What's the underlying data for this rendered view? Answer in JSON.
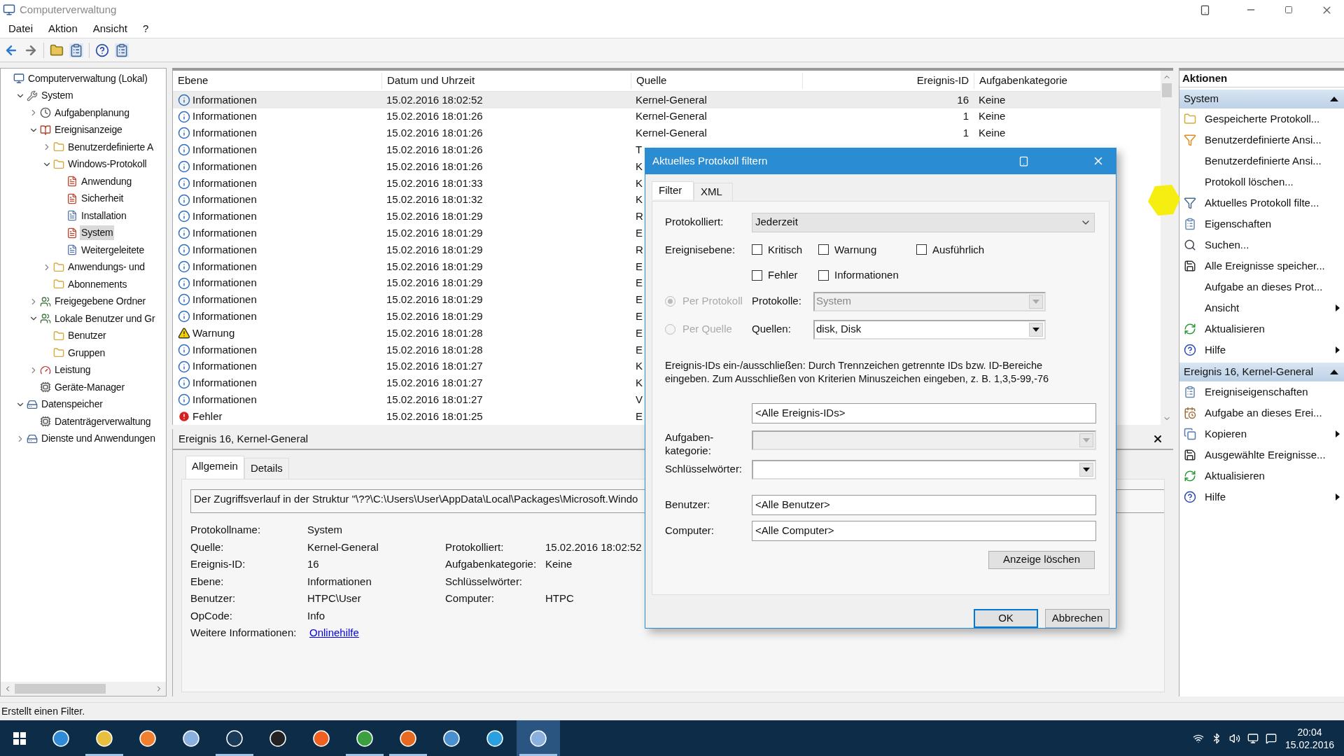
{
  "window": {
    "title": "Computerverwaltung"
  },
  "menu": [
    "Datei",
    "Aktion",
    "Ansicht",
    "?"
  ],
  "tree": [
    {
      "label": "Computerverwaltung (Lokal)",
      "kind": "computer",
      "selected": false,
      "children": [
        {
          "label": "System",
          "kind": "tool",
          "expanded": true,
          "selected": false,
          "children": [
            {
              "label": "Aufgabenplanung",
              "kind": "clock",
              "expanded": false,
              "selected": false
            },
            {
              "label": "Ereignisanzeige",
              "kind": "viewer",
              "expanded": true,
              "selected": false,
              "children": [
                {
                  "label": "Benutzerdefinierte A",
                  "kind": "folder",
                  "expanded": false,
                  "selected": false
                },
                {
                  "label": "Windows-Protokoll",
                  "kind": "folder",
                  "expanded": true,
                  "selected": false,
                  "children": [
                    {
                      "label": "Anwendung",
                      "kind": "log",
                      "selected": false
                    },
                    {
                      "label": "Sicherheit",
                      "kind": "log",
                      "selected": false
                    },
                    {
                      "label": "Installation",
                      "kind": "plainlog",
                      "selected": false
                    },
                    {
                      "label": "System",
                      "kind": "log",
                      "selected": true
                    },
                    {
                      "label": "Weitergeleitete",
                      "kind": "plainlog",
                      "selected": false
                    }
                  ]
                },
                {
                  "label": "Anwendungs- und",
                  "kind": "folder",
                  "expanded": false,
                  "selected": false
                },
                {
                  "label": "Abonnements",
                  "kind": "folder",
                  "selected": false
                }
              ]
            },
            {
              "label": "Freigegebene Ordner",
              "kind": "users",
              "expanded": false,
              "selected": false
            },
            {
              "label": "Lokale Benutzer und Gr",
              "kind": "users",
              "expanded": true,
              "selected": false,
              "children": [
                {
                  "label": "Benutzer",
                  "kind": "folder",
                  "selected": false
                },
                {
                  "label": "Gruppen",
                  "kind": "folder",
                  "selected": false
                }
              ]
            },
            {
              "label": "Leistung",
              "kind": "perf",
              "expanded": false,
              "selected": false
            },
            {
              "label": "Geräte-Manager",
              "kind": "device",
              "selected": false
            }
          ]
        },
        {
          "label": "Datenspeicher",
          "kind": "storage",
          "expanded": true,
          "selected": false,
          "children": [
            {
              "label": "Datenträgerverwaltung",
              "kind": "device",
              "selected": false
            }
          ]
        },
        {
          "label": "Dienste und Anwendungen",
          "kind": "storage",
          "expanded": false,
          "selected": false
        }
      ]
    }
  ],
  "table": {
    "columns": [
      "Ebene",
      "Datum und Uhrzeit",
      "Quelle",
      "Ereignis-ID",
      "Aufgabenkategorie"
    ],
    "rows": [
      {
        "kind": "info",
        "level": "Informationen",
        "date": "15.02.2016 18:02:52",
        "source": "Kernel-General",
        "id": "16",
        "category": "Keine",
        "selected": true
      },
      {
        "kind": "info",
        "level": "Informationen",
        "date": "15.02.2016 18:01:26",
        "source": "Kernel-General",
        "id": "1",
        "category": "Keine",
        "selected": false
      },
      {
        "kind": "info",
        "level": "Informationen",
        "date": "15.02.2016 18:01:26",
        "source": "Kernel-General",
        "id": "1",
        "category": "Keine",
        "selected": false
      },
      {
        "kind": "info",
        "level": "Informationen",
        "date": "15.02.2016 18:01:26",
        "source": "T",
        "selected": false
      },
      {
        "kind": "info",
        "level": "Informationen",
        "date": "15.02.2016 18:01:26",
        "source": "K",
        "selected": false
      },
      {
        "kind": "info",
        "level": "Informationen",
        "date": "15.02.2016 18:01:33",
        "source": "K",
        "selected": false
      },
      {
        "kind": "info",
        "level": "Informationen",
        "date": "15.02.2016 18:01:32",
        "source": "K",
        "selected": false
      },
      {
        "kind": "info",
        "level": "Informationen",
        "date": "15.02.2016 18:01:29",
        "source": "R",
        "selected": false
      },
      {
        "kind": "info",
        "level": "Informationen",
        "date": "15.02.2016 18:01:29",
        "source": "E",
        "selected": false
      },
      {
        "kind": "info",
        "level": "Informationen",
        "date": "15.02.2016 18:01:29",
        "source": "R",
        "selected": false
      },
      {
        "kind": "info",
        "level": "Informationen",
        "date": "15.02.2016 18:01:29",
        "source": "E",
        "selected": false
      },
      {
        "kind": "info",
        "level": "Informationen",
        "date": "15.02.2016 18:01:29",
        "source": "E",
        "selected": false
      },
      {
        "kind": "info",
        "level": "Informationen",
        "date": "15.02.2016 18:01:29",
        "source": "E",
        "selected": false
      },
      {
        "kind": "info",
        "level": "Informationen",
        "date": "15.02.2016 18:01:29",
        "source": "E",
        "selected": false
      },
      {
        "kind": "warning",
        "level": "Warnung",
        "date": "15.02.2016 18:01:28",
        "source": "E",
        "selected": false
      },
      {
        "kind": "info",
        "level": "Informationen",
        "date": "15.02.2016 18:01:28",
        "source": "E",
        "selected": false
      },
      {
        "kind": "info",
        "level": "Informationen",
        "date": "15.02.2016 18:01:27",
        "source": "K",
        "selected": false
      },
      {
        "kind": "info",
        "level": "Informationen",
        "date": "15.02.2016 18:01:27",
        "source": "K",
        "selected": false
      },
      {
        "kind": "info",
        "level": "Informationen",
        "date": "15.02.2016 18:01:27",
        "source": "V",
        "selected": false
      },
      {
        "kind": "error",
        "level": "Fehler",
        "date": "15.02.2016 18:01:25",
        "source": "E",
        "selected": false
      }
    ]
  },
  "details": {
    "title": "Ereignis 16, Kernel-General",
    "tabs": [
      {
        "label": "Allgemein",
        "selected": true
      },
      {
        "label": "Details",
        "selected": false
      }
    ],
    "message": "Der Zugriffsverlauf in der Struktur \"\\??\\C:\\Users\\User\\AppData\\Local\\Packages\\Microsoft.Windo",
    "rows": [
      {
        "left": {
          "label": "Protokollname:",
          "value": "System"
        }
      },
      {
        "left": {
          "label": "Quelle:",
          "value": "Kernel-General"
        },
        "right": {
          "label": "Protokolliert:",
          "value": "15.02.2016 18:02:52"
        }
      },
      {
        "left": {
          "label": "Ereignis-ID:",
          "value": "16"
        },
        "right": {
          "label": "Aufgabenkategorie:",
          "value": "Keine"
        }
      },
      {
        "left": {
          "label": "Ebene:",
          "value": "Informationen"
        },
        "right": {
          "label": "Schlüsselwörter:"
        }
      },
      {
        "left": {
          "label": "Benutzer:",
          "value": "HTPC\\User"
        },
        "right": {
          "label": "Computer:",
          "value": "HTPC"
        }
      },
      {
        "left": {
          "label": "OpCode:",
          "value": "Info"
        }
      }
    ],
    "more_info": {
      "label": "Weitere Informationen:",
      "link": "Onlinehilfe"
    }
  },
  "actions": {
    "title": "Aktionen",
    "sections": [
      {
        "title": "System",
        "expanded": true,
        "items": [
          {
            "label": "Gespeicherte Protokoll...",
            "kind": "folder",
            "submenu": false
          },
          {
            "label": "Benutzerdefinierte Ansi...",
            "kind": "filter",
            "submenu": false
          },
          {
            "label": "Benutzerdefinierte Ansi...",
            "kind": "none",
            "submenu": false
          },
          {
            "label": "Protokoll löschen...",
            "kind": "none",
            "submenu": false
          },
          {
            "label": "Aktuelles Protokoll filte...",
            "kind": "funnel",
            "submenu": false
          },
          {
            "label": "Eigenschaften",
            "kind": "props",
            "submenu": false
          },
          {
            "label": "Suchen...",
            "kind": "search",
            "submenu": false
          },
          {
            "label": "Alle Ereignisse speicher...",
            "kind": "save",
            "submenu": false
          },
          {
            "label": "Aufgabe an dieses Prot...",
            "kind": "none",
            "submenu": false
          },
          {
            "label": "Ansicht",
            "kind": "none",
            "submenu": true
          },
          {
            "label": "Aktualisieren",
            "kind": "refresh",
            "submenu": false
          },
          {
            "label": "Hilfe",
            "kind": "help",
            "submenu": true
          }
        ]
      },
      {
        "title": "Ereignis 16, Kernel-General",
        "expanded": true,
        "items": [
          {
            "label": "Ereigniseigenschaften",
            "kind": "props",
            "submenu": false
          },
          {
            "label": "Aufgabe an dieses Erei...",
            "kind": "task",
            "submenu": false
          },
          {
            "label": "Kopieren",
            "kind": "copy",
            "submenu": true
          },
          {
            "label": "Ausgewählte Ereignisse...",
            "kind": "save",
            "submenu": false
          },
          {
            "label": "Aktualisieren",
            "kind": "refresh",
            "submenu": false
          },
          {
            "label": "Hilfe",
            "kind": "help",
            "submenu": true
          }
        ]
      }
    ]
  },
  "dialog": {
    "title": "Aktuelles Protokoll filtern",
    "tabs": [
      {
        "label": "Filter",
        "selected": true
      },
      {
        "label": "XML",
        "selected": false
      }
    ],
    "logged": {
      "label": "Protokolliert:",
      "value": "Jederzeit"
    },
    "levels": {
      "label": "Ereignisebene:",
      "options": [
        {
          "label": "Kritisch",
          "checked": false
        },
        {
          "label": "Warnung",
          "checked": false
        },
        {
          "label": "Ausführlich",
          "checked": false
        },
        {
          "label": "Fehler",
          "checked": false
        },
        {
          "label": "Informationen",
          "checked": false
        }
      ]
    },
    "modes": [
      {
        "label": "Per Protokoll",
        "selected": true,
        "disabled": true,
        "field": {
          "label": "Protokolle:",
          "value": "System",
          "disabled": true
        }
      },
      {
        "label": "Per Quelle",
        "selected": false,
        "disabled": true,
        "field": {
          "label": "Quellen:",
          "value": "disk, Disk",
          "disabled": false
        }
      }
    ],
    "ids_hint": "Ereignis-IDs ein-/ausschließen: Durch Trennzeichen getrennte IDs bzw. ID-Bereiche eingeben. Zum Ausschließen von Kriterien Minuszeichen eingeben, z. B. 1,3,5-99,-76",
    "ids": {
      "value": "<Alle Ereignis-IDs>"
    },
    "task_category": {
      "label": "Aufgaben-kategorie:",
      "disabled": true
    },
    "keywords": {
      "label": "Schlüsselwörter:",
      "disabled": false
    },
    "user": {
      "label": "Benutzer:",
      "value": "<Alle Benutzer>"
    },
    "computer": {
      "label": "Computer:",
      "value": "<Alle Computer>"
    },
    "clear_button": "Anzeige löschen",
    "buttons": [
      {
        "label": "OK",
        "default": true
      },
      {
        "label": "Abbrechen",
        "default": false
      }
    ]
  },
  "status_bar": "Erstellt einen Filter.",
  "taskbar": {
    "apps": [
      {
        "kind": "edge",
        "running": false,
        "selected": false
      },
      {
        "kind": "explorer",
        "running": true,
        "selected": false
      },
      {
        "kind": "media",
        "running": false,
        "selected": false
      },
      {
        "kind": "remote",
        "running": false,
        "selected": false
      },
      {
        "kind": "steam",
        "running": true,
        "selected": false
      },
      {
        "kind": "player",
        "running": false,
        "selected": false
      },
      {
        "kind": "origin",
        "running": false,
        "selected": false
      },
      {
        "kind": "chrome",
        "running": true,
        "selected": false
      },
      {
        "kind": "firefox",
        "running": true,
        "selected": false
      },
      {
        "kind": "card",
        "running": false,
        "selected": false
      },
      {
        "kind": "ie",
        "running": false,
        "selected": false
      },
      {
        "kind": "mgmt",
        "running": true,
        "selected": true
      }
    ],
    "time": "20:04",
    "date": "15.02.2016"
  }
}
